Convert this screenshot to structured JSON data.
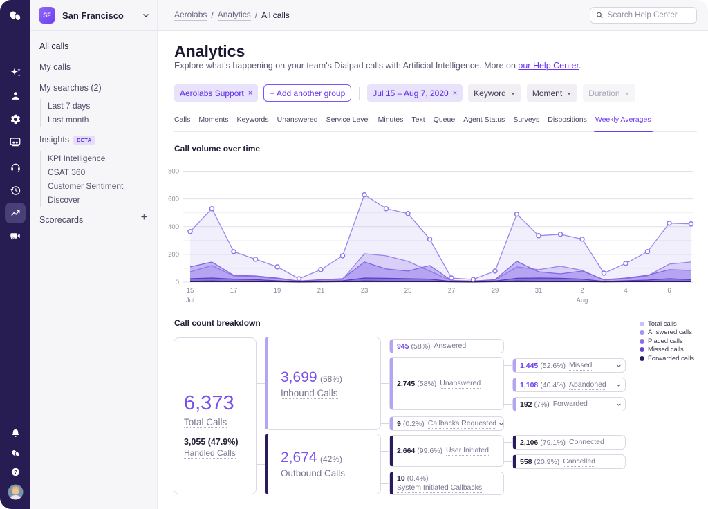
{
  "rail": {
    "icons": [
      "dialpad-logo",
      "ai-sparkle",
      "contacts",
      "settings-gear",
      "meetings",
      "support-headset",
      "history",
      "analytics-trend",
      "video-settings",
      "notifications-bell",
      "dialpad-mini",
      "help",
      "user-avatar"
    ]
  },
  "sidebar": {
    "workspace": {
      "badge": "SF",
      "name": "San Francisco"
    },
    "items": [
      {
        "label": "All calls"
      },
      {
        "label": "My calls"
      },
      {
        "label": "My searches (2)"
      },
      {
        "label": "Last 7 days"
      },
      {
        "label": "Last month"
      },
      {
        "label": "Insights",
        "badge": "BETA"
      },
      {
        "label": "KPI Intelligence"
      },
      {
        "label": "CSAT 360"
      },
      {
        "label": "Customer Sentiment"
      },
      {
        "label": "Discover"
      },
      {
        "label": "Scorecards"
      }
    ],
    "add_button": "+"
  },
  "topbar": {
    "breadcrumb": {
      "0": "Aerolabs",
      "1": "Analytics",
      "2": "All calls",
      "sep": "/"
    },
    "search_placeholder": "Search Help Center"
  },
  "header": {
    "title": "Analytics",
    "subtitle_prefix": "Explore what's happening on your team's Dialpad calls with Artificial Intelligence. More on ",
    "subtitle_link": "our Help Center",
    "subtitle_suffix": "."
  },
  "filters": {
    "group_chip": "Aerolabs Support",
    "remove": "×",
    "add_group": "+ Add another group",
    "date_chip": "Jul 15 – Aug 7, 2020",
    "keyword": "Keyword",
    "moment": "Moment",
    "duration": "Duration"
  },
  "tabs": {
    "items": [
      {
        "label": "Calls"
      },
      {
        "label": "Moments"
      },
      {
        "label": "Keywords"
      },
      {
        "label": "Unanswered"
      },
      {
        "label": "Service Level"
      },
      {
        "label": "Minutes"
      },
      {
        "label": "Text"
      },
      {
        "label": "Queue"
      },
      {
        "label": "Agent Status"
      },
      {
        "label": "Surveys"
      },
      {
        "label": "Dispositions"
      },
      {
        "label": "Weekly Averages"
      }
    ],
    "active": "Weekly Averages"
  },
  "chart_data": {
    "type": "area",
    "title": "Call volume over time",
    "x": [
      "Jul 15",
      "Jul 16",
      "Jul 17",
      "Jul 18",
      "Jul 19",
      "Jul 20",
      "Jul 21",
      "Jul 22",
      "Jul 23",
      "Jul 24",
      "Jul 25",
      "Jul 26",
      "Jul 27",
      "Jul 28",
      "Jul 29",
      "Jul 30",
      "Jul 31",
      "Aug 1",
      "Aug 2",
      "Aug 3",
      "Aug 4",
      "Aug 5",
      "Aug 6",
      "Aug 7"
    ],
    "x_ticks": [
      {
        "i": 0,
        "label": "15",
        "month": "Jul"
      },
      {
        "i": 2,
        "label": "17"
      },
      {
        "i": 4,
        "label": "19"
      },
      {
        "i": 6,
        "label": "21"
      },
      {
        "i": 8,
        "label": "23"
      },
      {
        "i": 10,
        "label": "25"
      },
      {
        "i": 12,
        "label": "27"
      },
      {
        "i": 14,
        "label": "29"
      },
      {
        "i": 16,
        "label": "31"
      },
      {
        "i": 18,
        "label": "2",
        "month": "Aug"
      },
      {
        "i": 20,
        "label": "4"
      },
      {
        "i": 22,
        "label": "6"
      }
    ],
    "ylim": [
      0,
      800
    ],
    "ytick_step": 200,
    "grid": true,
    "series": [
      {
        "name": "Total calls",
        "stroke": "#9b84ee",
        "fill": "rgba(151,128,238,0.13)",
        "markers": true,
        "values": [
          365,
          530,
          220,
          165,
          110,
          25,
          90,
          190,
          630,
          530,
          495,
          310,
          30,
          20,
          80,
          490,
          335,
          345,
          310,
          65,
          135,
          220,
          425,
          420
        ]
      },
      {
        "name": "Placed calls",
        "stroke": "#9a82ec",
        "fill": "rgba(151,128,238,0.28)",
        "values": [
          75,
          120,
          45,
          40,
          25,
          5,
          15,
          20,
          205,
          190,
          150,
          80,
          10,
          5,
          15,
          110,
          90,
          115,
          85,
          15,
          25,
          45,
          130,
          145
        ]
      },
      {
        "name": "Answered calls",
        "stroke": "#8465e4",
        "fill": "rgba(130,102,232,0.42)",
        "values": [
          110,
          145,
          50,
          45,
          30,
          8,
          18,
          25,
          145,
          95,
          80,
          120,
          12,
          8,
          18,
          150,
          75,
          60,
          80,
          18,
          30,
          50,
          90,
          85
        ]
      },
      {
        "name": "Missed calls",
        "stroke": "#5a3cc8",
        "fill": "rgba(90,60,200,0.5)",
        "values": [
          25,
          30,
          22,
          18,
          10,
          3,
          6,
          10,
          30,
          28,
          25,
          22,
          5,
          3,
          8,
          28,
          30,
          28,
          22,
          5,
          10,
          15,
          25,
          18
        ]
      },
      {
        "name": "Forwarded calls",
        "stroke": "#2a1a50",
        "fill": "rgba(38,26,80,0.85)",
        "values": [
          6,
          8,
          5,
          4,
          3,
          1,
          2,
          3,
          8,
          7,
          6,
          5,
          2,
          1,
          3,
          8,
          7,
          6,
          5,
          2,
          3,
          4,
          6,
          5
        ]
      }
    ],
    "legend": [
      {
        "label": "Total calls",
        "color": "#cdc0f6"
      },
      {
        "label": "Answered calls",
        "color": "#a793ee"
      },
      {
        "label": "Placed calls",
        "color": "#8a6fe6"
      },
      {
        "label": "Missed calls",
        "color": "#6344d4"
      },
      {
        "label": "Forwarded calls",
        "color": "#2a1a5e"
      }
    ]
  },
  "breakdown": {
    "title": "Call count breakdown",
    "total": {
      "value": "6,373",
      "label": "Total Calls",
      "sub_value": "3,055 (47.9%)",
      "sub_label": "Handled Calls"
    },
    "inbound": {
      "value": "3,699",
      "pct": "(58%)",
      "label": "Inbound Calls"
    },
    "outbound": {
      "value": "2,674",
      "pct": "(42%)",
      "label": "Outbound Calls"
    },
    "answered": {
      "value": "945",
      "pct": "(58%)",
      "label": "Answered"
    },
    "unanswered": {
      "value": "2,745",
      "pct": "(58%)",
      "label": "Unanswered"
    },
    "callbacks": {
      "value": "9",
      "pct": "(0.2%)",
      "label": "Callbacks Requested"
    },
    "user_initiated": {
      "value": "2,664",
      "pct": "(99.6%)",
      "label": "User Initiated"
    },
    "system_initiated": {
      "value": "10",
      "pct": "(0.4%)",
      "label": "System Initiated Callbacks"
    },
    "missed": {
      "value": "1,445",
      "pct": "(52.6%)",
      "label": "Missed"
    },
    "abandoned": {
      "value": "1,108",
      "pct": "(40.4%)",
      "label": "Abandoned"
    },
    "forwarded": {
      "value": "192",
      "pct": "(7%)",
      "label": "Forwarded"
    },
    "connected": {
      "value": "2,106",
      "pct": "(79.1%)",
      "label": "Connected"
    },
    "cancelled": {
      "value": "558",
      "pct": "(20.9%)",
      "label": "Cancelled"
    }
  }
}
